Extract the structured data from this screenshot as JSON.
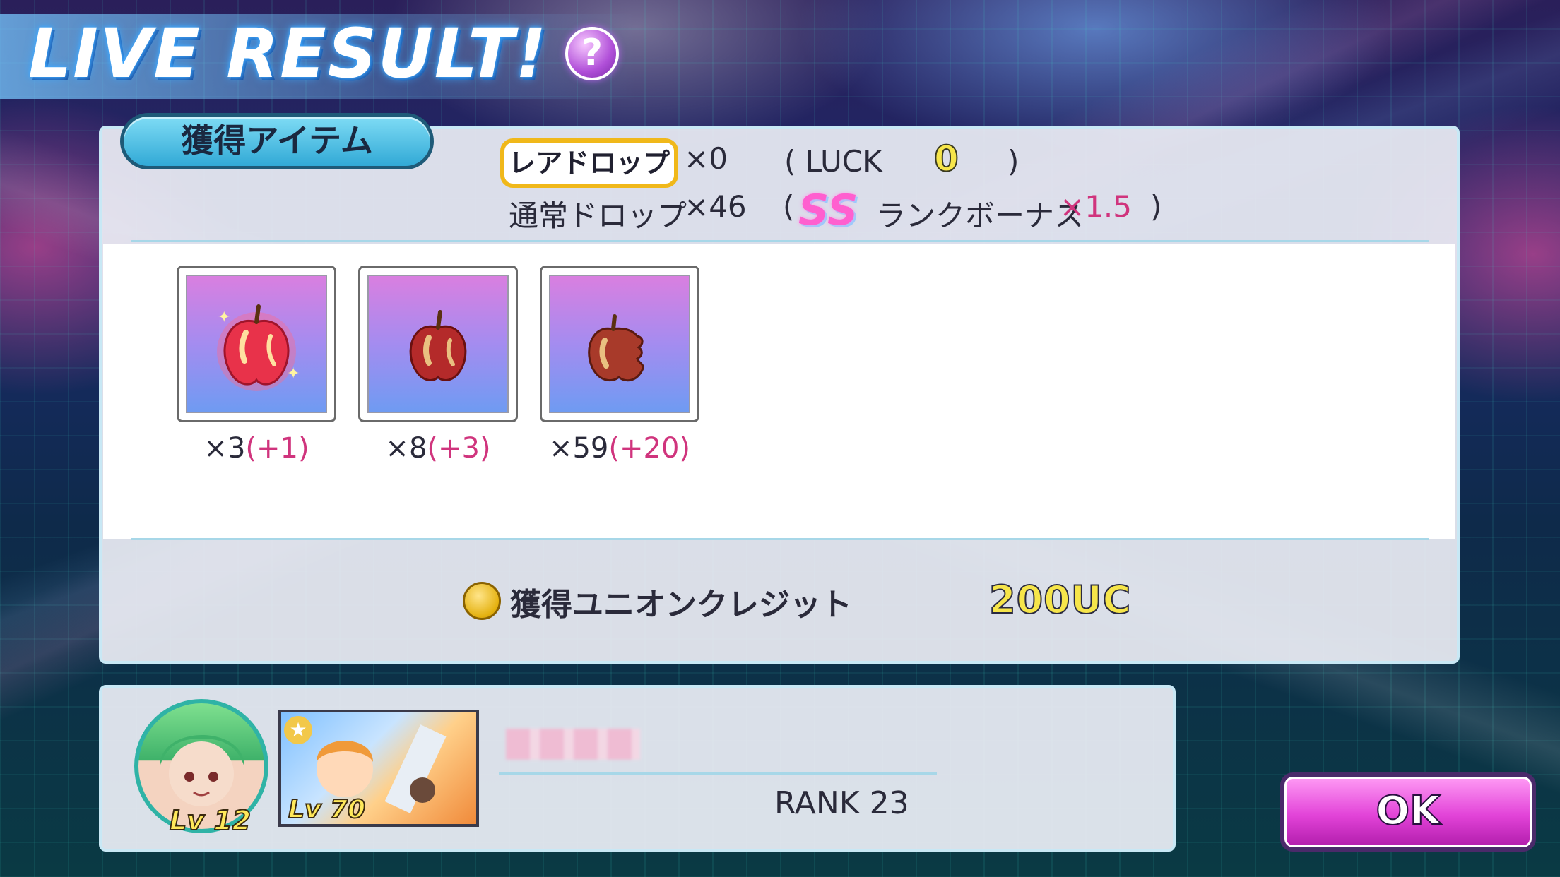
{
  "header": {
    "title": "LIVE RESULT!",
    "help_label": "?"
  },
  "items_panel": {
    "tab_label": "獲得アイテム",
    "rare_drop_label": "レアドロップ",
    "rare_drop_count": "×0",
    "luck_prefix": "( LUCK",
    "luck_value": "0",
    "luck_suffix": ")",
    "normal_drop_label": "通常ドロップ",
    "normal_drop_count": "×46",
    "rank_bonus_open": "(",
    "rank_badge": "SS",
    "rank_bonus_label": "ランクボーナス",
    "rank_bonus_mult": "×1.5",
    "rank_bonus_close": ")",
    "items": [
      {
        "icon": "golden-apple-icon",
        "count": "×3",
        "bonus": "(+1)"
      },
      {
        "icon": "apple-icon",
        "count": "×8",
        "bonus": "(+3)"
      },
      {
        "icon": "bitten-apple-icon",
        "count": "×59",
        "bonus": "(+20)"
      }
    ],
    "uc_label": "獲得ユニオンクレジット",
    "uc_value": "200UC"
  },
  "player": {
    "avatar_level": "Lv 12",
    "card_level": "Lv 70",
    "rank_label": "RANK 23"
  },
  "ok_label": "OK",
  "colors": {
    "accent_pink": "#d0347d",
    "ok_button": "#e243d8",
    "rare_border": "#f0b81a",
    "panel_border": "#c8e8f5"
  }
}
